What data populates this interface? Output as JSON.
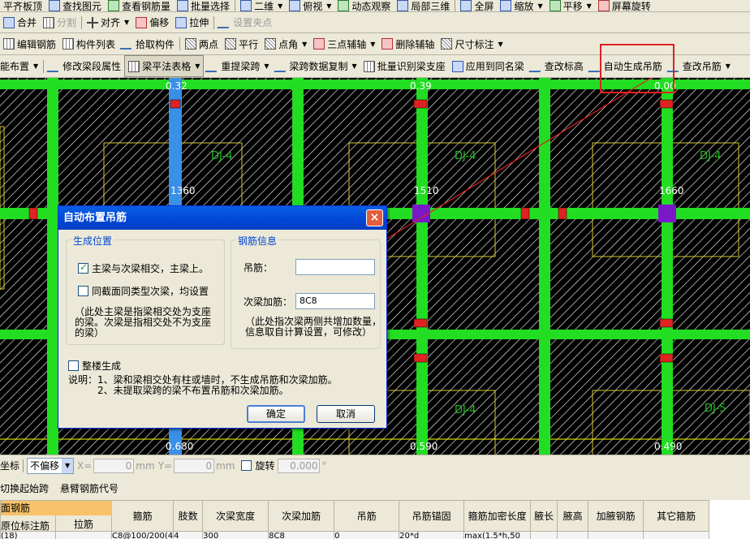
{
  "toolbar1": {
    "items": [
      "平齐板顶",
      "查找图元",
      "查看钢筋量",
      "批量选择",
      "二维",
      "俯视",
      "动态观察",
      "局部三维",
      "全屏",
      "缩放",
      "平移",
      "屏幕旋转"
    ]
  },
  "toolbar2": {
    "items": [
      "合并",
      "分割",
      "对齐",
      "偏移",
      "拉伸",
      "设置夹点"
    ]
  },
  "toolbar3": {
    "items": [
      "编辑钢筋",
      "构件列表",
      "拾取构件",
      "两点",
      "平行",
      "点角",
      "三点辅轴",
      "删除辅轴",
      "尺寸标注"
    ]
  },
  "toolbar4": {
    "items": [
      "能布置",
      "修改梁段属性",
      "梁平法表格",
      "重提梁跨",
      "梁跨数据复制",
      "批量识别梁支座",
      "应用到同名梁",
      "查改标高",
      "自动生成吊筋",
      "查改吊筋"
    ]
  },
  "canvas": {
    "labels": [
      "DJ-4",
      "DJ-4",
      "DJ-4",
      "DJ-4",
      "DJ-5"
    ],
    "dims": [
      "1360",
      "1510",
      "1660"
    ],
    "marks": [
      "0.32",
      "0.39",
      "0.00",
      "0.680",
      "0.590",
      "0.490"
    ],
    "colors": {
      "beam": "#22dd22",
      "mainbeam": "#3a8fe6",
      "axis": "#ffff00",
      "cap": "#7a18c8",
      "rebar": "#e02222"
    }
  },
  "dialog": {
    "title": "自动布置吊筋",
    "close_glyph": "×",
    "group_position": "生成位置",
    "opt_main_sub": "主梁与次梁相交，主梁上。",
    "opt_same_section": "同截面同类型次梁，均设置",
    "note_position": "（此处主梁是指梁相交处为支座的梁。次梁是指相交处不为支座的梁）",
    "group_rebar": "钢筋信息",
    "label_hanger": "吊筋：",
    "hanger_value": "",
    "label_extra": "次梁加筋：",
    "extra_value": "8C8",
    "note_rebar": "（此处指次梁两侧共增加数量，信息取自计算设置，可修改）",
    "opt_whole_floor": "整楼生成",
    "desc_title": "说明：1、梁和梁相交处有柱或墙时，不生成吊筋和次梁加筋。",
    "desc_line2": "2、未提取梁跨的梁不布置吊筋和次梁加筋。",
    "ok": "确定",
    "cancel": "取消"
  },
  "status": {
    "coord_label": "坐标",
    "offset_value": "不偏移",
    "x_label": "X=",
    "x_value": "0",
    "y_label": "Y=",
    "y_value": "0",
    "unit": "mm",
    "rotate_label": "旋转",
    "rotate_value": "0.000",
    "deg": "°"
  },
  "line2": {
    "items": [
      "切换起始跨",
      "悬臂钢筋代号"
    ]
  },
  "grid": {
    "tab": "面钢筋",
    "headers": [
      "原位标注筋",
      "拉筋",
      "箍筋",
      "肢数",
      "次梁宽度",
      "次梁加筋",
      "吊筋",
      "吊筋锚固",
      "箍筋加密长度",
      "腋长",
      "腋高",
      "加腋钢筋",
      "其它箍筋"
    ],
    "row": [
      "(18)",
      "",
      "C8@100/200(4",
      "4",
      "300",
      "8C8",
      "0",
      "20*d",
      "max(1.5*h,50",
      "",
      "",
      "",
      ""
    ]
  }
}
